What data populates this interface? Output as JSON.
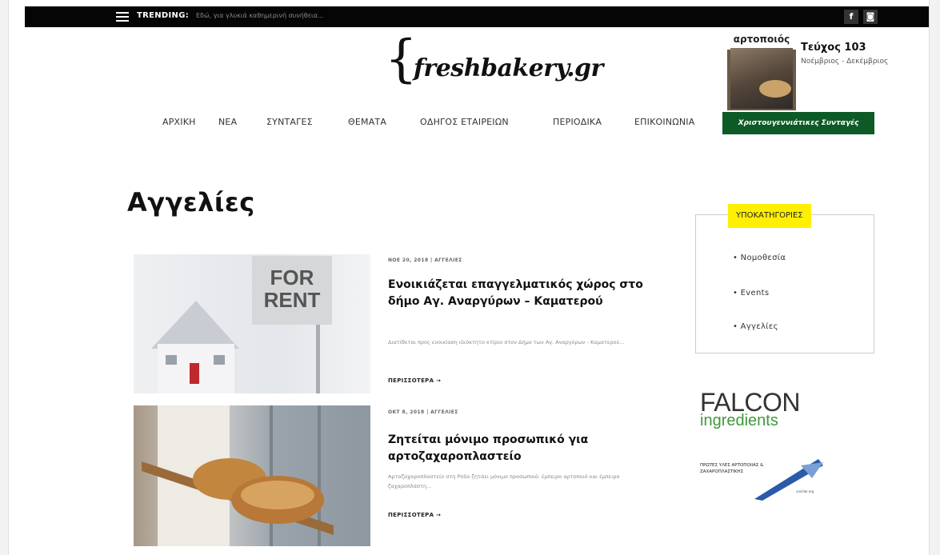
{
  "topbar": {
    "trending_label": "TRENDING:",
    "trending_text": "Εδώ, για γλυκιά καθημερινή συνήθεια...",
    "social": [
      {
        "icon": "facebook-icon",
        "glyph": "f"
      },
      {
        "icon": "instagram-icon",
        "glyph": "◙"
      }
    ]
  },
  "logo": {
    "brace": "{",
    "text": "freshbakery.gr"
  },
  "magazine": {
    "cover_title": "αρτοποιός",
    "issue": "Τεύχος 103",
    "period": "Νοέμβριος - Δεκέμβριος"
  },
  "nav": {
    "items": [
      "ΑΡΧΙΚΗ",
      "ΝΕΑ",
      "ΣΥΝΤΑΓΕΣ",
      "ΘΕΜΑΤΑ",
      "ΟΔΗΓΟΣ ΕΤΑΙΡΕΙΩΝ",
      "ΠΕΡΙΟΔΙΚΑ",
      "ΕΠΙΚΟΙΝΩΝΙΑ"
    ],
    "special": "Χριστουγεννιάτικες Συνταγές"
  },
  "page_title": "Αγγελίες",
  "posts": [
    {
      "meta": "ΝΟΕ 20, 2018 | ΑΓΓΕΛΙΕΣ",
      "title": "Ενοικιάζεται επαγγελματικός χώρος στο δήμο Αγ. Αναργύρων – Καματερού",
      "excerpt": "Διατίθεται προς ενοικίαση ιδιόκτητο κτίριο στον Δήμο των Αγ. Αναργύρων - Καματερού...",
      "more": "ΠΕΡΙΣΣΟΤΕΡΑ →",
      "sign_text_1": "FOR",
      "sign_text_2": "RENT"
    },
    {
      "meta": "ΟΚΤ 8, 2018 | ΑΓΓΕΛΙΕΣ",
      "title": "Ζητείται μόνιμο προσωπικό για αρτοζαχαροπλαστείο",
      "excerpt": "Αρτοζαχαροπλαστείο στη Ρόδο ζητάει μόνιμο προσωπικό: έμπειρο αρτοποιό και έμπειρο ζαχαροπλάστη...",
      "more": "ΠΕΡΙΣΣΟΤΕΡΑ →"
    }
  ],
  "sidebar": {
    "subcat_heading": "ΥΠΟΚΑΤΗΓΟΡΙΕΣ",
    "subcats": [
      "• Νομοθεσία",
      "• Events",
      "• Αγγελίες"
    ],
    "ad1": {
      "name": "FALCON",
      "sub": "ingredients"
    },
    "ad2": {
      "text": "ΠΡΩΤΕΣ ΥΛΕΣ ΑΡΤΟΠΟΙΙΑΣ & ΖΑΧΑΡΟΠΛΑΣΤΙΚΗΣ",
      "small": "vanillar.org"
    }
  },
  "colors": {
    "topbar": "#050505",
    "nav_special": "#0d5a27",
    "subcat_head": "#ffef00",
    "falcon_green": "#3f9a3a"
  }
}
